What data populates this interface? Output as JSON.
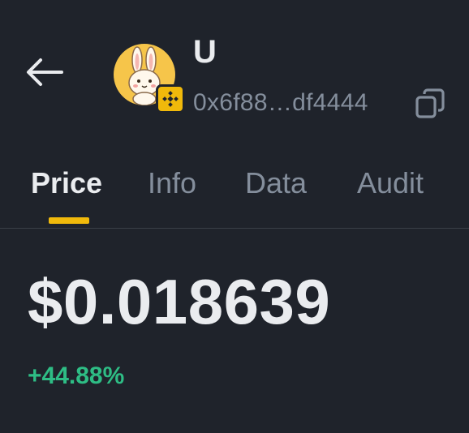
{
  "header": {
    "back_icon": "arrow-left-icon",
    "token": {
      "name": "U",
      "address": "0x6f88…df4444",
      "avatar_icon": "bunny-avatar-icon",
      "chain_badge_icon": "bnb-chain-icon",
      "copy_icon": "copy-icon"
    }
  },
  "tabs": [
    {
      "label": "Price",
      "active": true
    },
    {
      "label": "Info",
      "active": false
    },
    {
      "label": "Data",
      "active": false
    },
    {
      "label": "Audit",
      "active": false
    }
  ],
  "price": {
    "value": "$0.018639",
    "change": "+44.88%"
  },
  "colors": {
    "background": "#1f232b",
    "primary_text": "#eaecef",
    "secondary_text": "#848e9c",
    "accent": "#f0b90b",
    "positive": "#2ebd85"
  }
}
